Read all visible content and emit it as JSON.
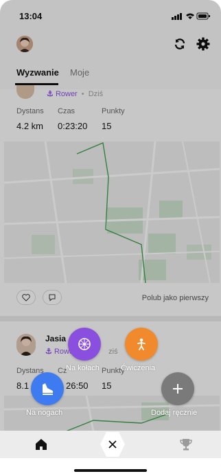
{
  "status_bar": {
    "time": "13:04"
  },
  "header": {
    "avatar": "profile-avatar",
    "refresh_icon": "refresh-icon",
    "settings_icon": "gear-icon"
  },
  "tabs": [
    {
      "label": "Wyzwanie",
      "active": true
    },
    {
      "label": "Moje",
      "active": false
    }
  ],
  "feed": [
    {
      "sport_icon": "bike-icon",
      "sport": "Rower",
      "date": "Dziś",
      "stats": [
        {
          "label": "Dystans",
          "value": "4.2 km"
        },
        {
          "label": "Czas",
          "value": "0:23:20"
        },
        {
          "label": "Punkty",
          "value": "15"
        }
      ],
      "actions": {
        "like_icon": "heart-icon",
        "comment_icon": "comment-icon",
        "like_first": "Polub jako pierwszy"
      }
    },
    {
      "name": "Jasia",
      "sport_icon": "bike-icon",
      "sport": "Rowe",
      "date": "ziś",
      "stats": [
        {
          "label": "Dystans",
          "value": "8.1"
        },
        {
          "label": "Cz",
          "value": "26:50"
        },
        {
          "label": "Punkty",
          "value": "15"
        }
      ]
    }
  ],
  "quick_add": [
    {
      "label": "Na kołach",
      "icon": "wheel-icon",
      "color": "#8b4fe0"
    },
    {
      "label": "Ćwiczenia",
      "icon": "exercise-icon",
      "color": "#f08a2c"
    },
    {
      "label": "Na nogach",
      "icon": "shoe-icon",
      "color": "#3f7bf0"
    },
    {
      "label": "Dodaj ręcznie",
      "icon": "plus-icon",
      "color": "#7a7a7a"
    }
  ],
  "bottom_nav": {
    "home_icon": "home-icon",
    "close_icon": "close-icon",
    "trophy_icon": "trophy-icon"
  }
}
